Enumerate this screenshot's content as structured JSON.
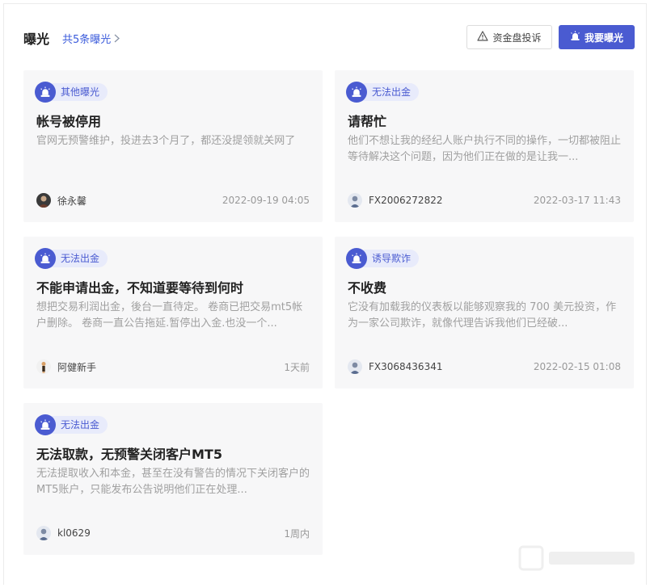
{
  "header": {
    "title": "曝光",
    "count_link": "共5条曝光",
    "complain_button": "资金盘投诉",
    "expose_button": "我要曝光"
  },
  "cards": [
    {
      "tag": "其他曝光",
      "title": "帐号被停用",
      "desc": "官网无预警维护，投进去3个月了，都还没提领就关网了",
      "author": "徐永馨",
      "time": "2022-09-19 04:05"
    },
    {
      "tag": "无法出金",
      "title": "请帮忙",
      "desc": "他们不想让我的经纪人账户执行不同的操作，一切都被阻止等待解决这个问题，因为他们正在做的是让我一...",
      "author": "FX2006272822",
      "time": "2022-03-17 11:43"
    },
    {
      "tag": "无法出金",
      "title": "不能申请出金，不知道要等待到何时",
      "desc": "想把交易利润出金，後台一直待定。 卷商已把交易mt5帐户删除。 卷商一直公告拖延.暂停出入金.也没一个...",
      "author": "阿健新手",
      "time": "1天前"
    },
    {
      "tag": "诱导欺诈",
      "title": "不收费",
      "desc": "它没有加载我的仪表板以能够观察我的 700 美元投资，作为一家公司欺诈，就像代理告诉我他们已经破...",
      "author": "FX3068436341",
      "time": "2022-02-15 01:08"
    },
    {
      "tag": "无法出金",
      "title": "无法取款，无预警关闭客户MT5",
      "desc": "无法提取收入和本金，甚至在没有警告的情况下关闭客户的MT5账户，只能发布公告说明他们正在处理...",
      "author": "kl0629",
      "time": "1周内"
    }
  ],
  "icons": {
    "tag": "alarm-siren-icon",
    "complain": "warning-triangle-icon",
    "expose": "alarm-siren-icon",
    "chevron": "chevron-right-icon"
  },
  "colors": {
    "accent": "#4a5bd1",
    "tag_bg": "#e8ebfb",
    "card_bg": "#f7f7f8"
  }
}
